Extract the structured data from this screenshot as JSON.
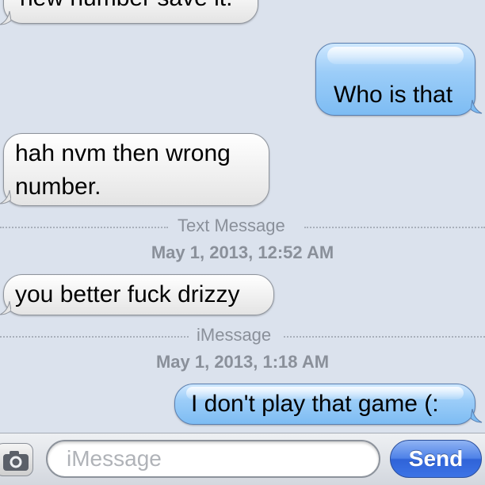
{
  "thread": {
    "messages": [
      {
        "direction": "incoming",
        "text": "new number save it."
      },
      {
        "direction": "outgoing",
        "text": "Who is that"
      },
      {
        "direction": "incoming",
        "text_lines": [
          "hah nvm then wrong",
          "number."
        ]
      },
      {
        "direction": "incoming",
        "text": "you better fuck drizzy"
      },
      {
        "direction": "outgoing",
        "text": "I don't play that game (:"
      }
    ],
    "dividers": [
      {
        "label": "Text Message",
        "timestamp": "May 1, 2013, 12:52 AM"
      },
      {
        "label": "iMessage",
        "timestamp": "May 1, 2013, 1:18 AM"
      }
    ]
  },
  "input_bar": {
    "camera_icon": "camera-icon",
    "placeholder": "iMessage",
    "value": "",
    "send_label": "Send"
  },
  "colors": {
    "background": "#dbe2ed",
    "incoming_bubble": "#f3f3f3",
    "outgoing_bubble": "#9ccdf8",
    "send_button": "#3d74e6",
    "meta_text": "#8a909a"
  }
}
